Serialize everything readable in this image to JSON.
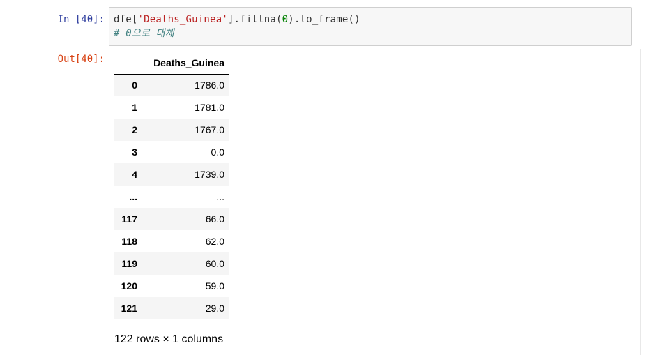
{
  "cell": {
    "in_prompt": "In [40]:",
    "out_prompt": "Out[40]:",
    "code": {
      "line1_a": "dfe[",
      "line1_str": "'Deaths_Guinea'",
      "line1_b": "].fillna(",
      "line1_num": "0",
      "line1_c": ").to_frame()",
      "line2_comment": "# 0으로 대체"
    }
  },
  "dataframe": {
    "index_header": "",
    "column_header": "Deaths_Guinea",
    "rows": [
      {
        "index": "0",
        "value": "1786.0"
      },
      {
        "index": "1",
        "value": "1781.0"
      },
      {
        "index": "2",
        "value": "1767.0"
      },
      {
        "index": "3",
        "value": "0.0"
      },
      {
        "index": "4",
        "value": "1739.0"
      },
      {
        "index": "...",
        "value": "..."
      },
      {
        "index": "117",
        "value": "66.0"
      },
      {
        "index": "118",
        "value": "62.0"
      },
      {
        "index": "119",
        "value": "60.0"
      },
      {
        "index": "120",
        "value": "59.0"
      },
      {
        "index": "121",
        "value": "29.0"
      }
    ],
    "shape_text": "122 rows × 1 columns"
  }
}
